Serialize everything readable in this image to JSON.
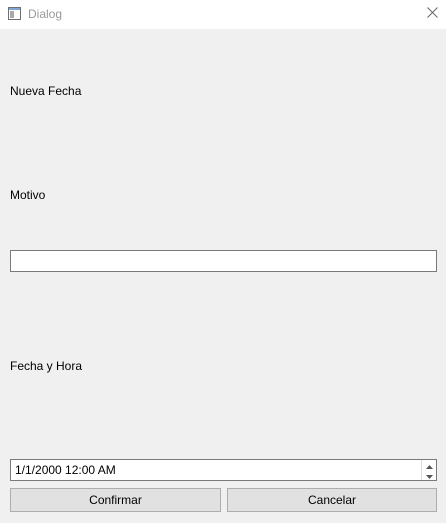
{
  "window": {
    "title": "Dialog"
  },
  "labels": {
    "new_date": "Nueva Fecha",
    "reason": "Motivo",
    "date_time": "Fecha y Hora"
  },
  "reason_input": {
    "value": "",
    "placeholder": ""
  },
  "datetime_input": {
    "value": "1/1/2000 12:00 AM"
  },
  "buttons": {
    "confirm": "Confirmar",
    "cancel": "Cancelar"
  },
  "icons": {
    "app": "window-app-icon",
    "close": "close-icon",
    "up": "spin-up-icon",
    "down": "spin-down-icon"
  },
  "colors": {
    "background": "#f0f0f0",
    "titlebar": "#ffffff",
    "title_text": "#999999",
    "button_face": "#e1e1e1"
  }
}
